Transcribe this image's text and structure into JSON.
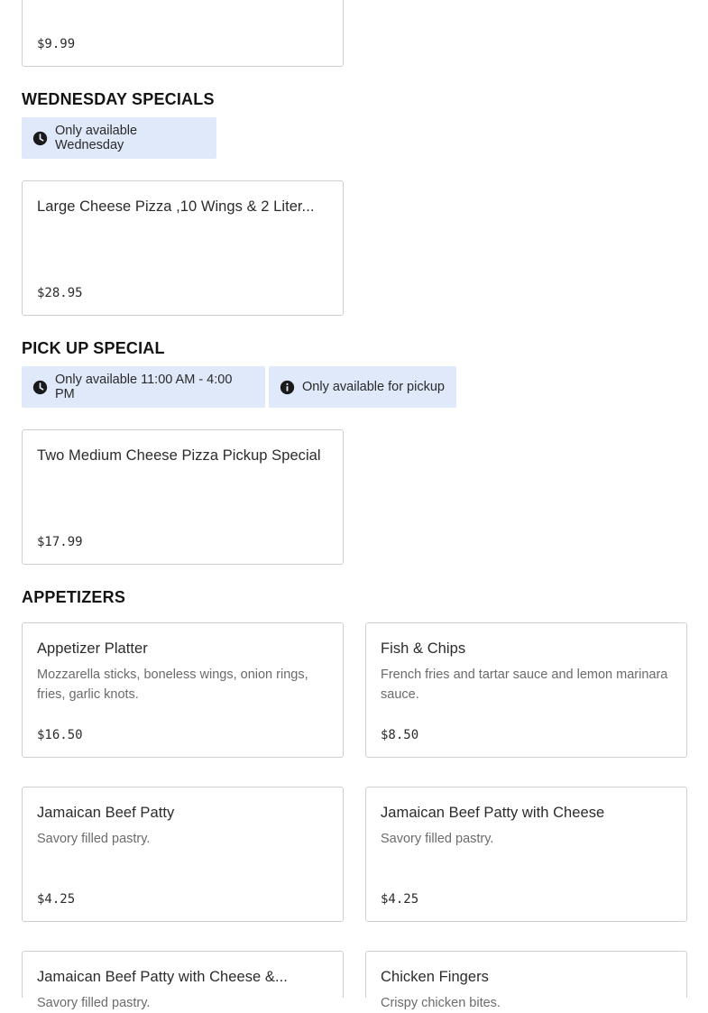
{
  "top_partial": {
    "price": "$9.99"
  },
  "sections": {
    "wednesday": {
      "title": "WEDNESDAY SPECIALS",
      "badge": "Only available Wednesday",
      "item": {
        "name": "Large Cheese Pizza ,10 Wings & 2 Liter...",
        "price": "$28.95"
      }
    },
    "pickup": {
      "title": "PICK UP SPECIAL",
      "badge_time": "Only available 11:00 AM - 4:00 PM",
      "badge_pickup": "Only available for pickup",
      "item": {
        "name": "Two Medium Cheese Pizza Pickup Special",
        "price": "$17.99"
      }
    },
    "appetizers": {
      "title": "APPETIZERS",
      "items": [
        {
          "name": "Appetizer Platter",
          "desc": "Mozzarella sticks, boneless wings, onion rings, fries, garlic knots.",
          "price": "$16.50"
        },
        {
          "name": "Fish & Chips",
          "desc": "French fries and tartar sauce and lemon marinara sauce.",
          "price": "$8.50"
        },
        {
          "name": "Jamaican Beef Patty",
          "desc": "Savory filled pastry.",
          "price": "$4.25"
        },
        {
          "name": "Jamaican Beef Patty with Cheese",
          "desc": "Savory filled pastry.",
          "price": "$4.25"
        },
        {
          "name": "Jamaican Beef Patty with Cheese &...",
          "desc": "Savory filled pastry."
        },
        {
          "name": "Chicken Fingers",
          "desc": "Crispy chicken bites."
        }
      ]
    }
  },
  "icons": {
    "clock": "clock-icon",
    "info": "info-icon"
  },
  "colors": {
    "badge_bg": "#dfe9fa",
    "card_border": "#cfcfcf",
    "price_text": "#2b2b2b"
  }
}
